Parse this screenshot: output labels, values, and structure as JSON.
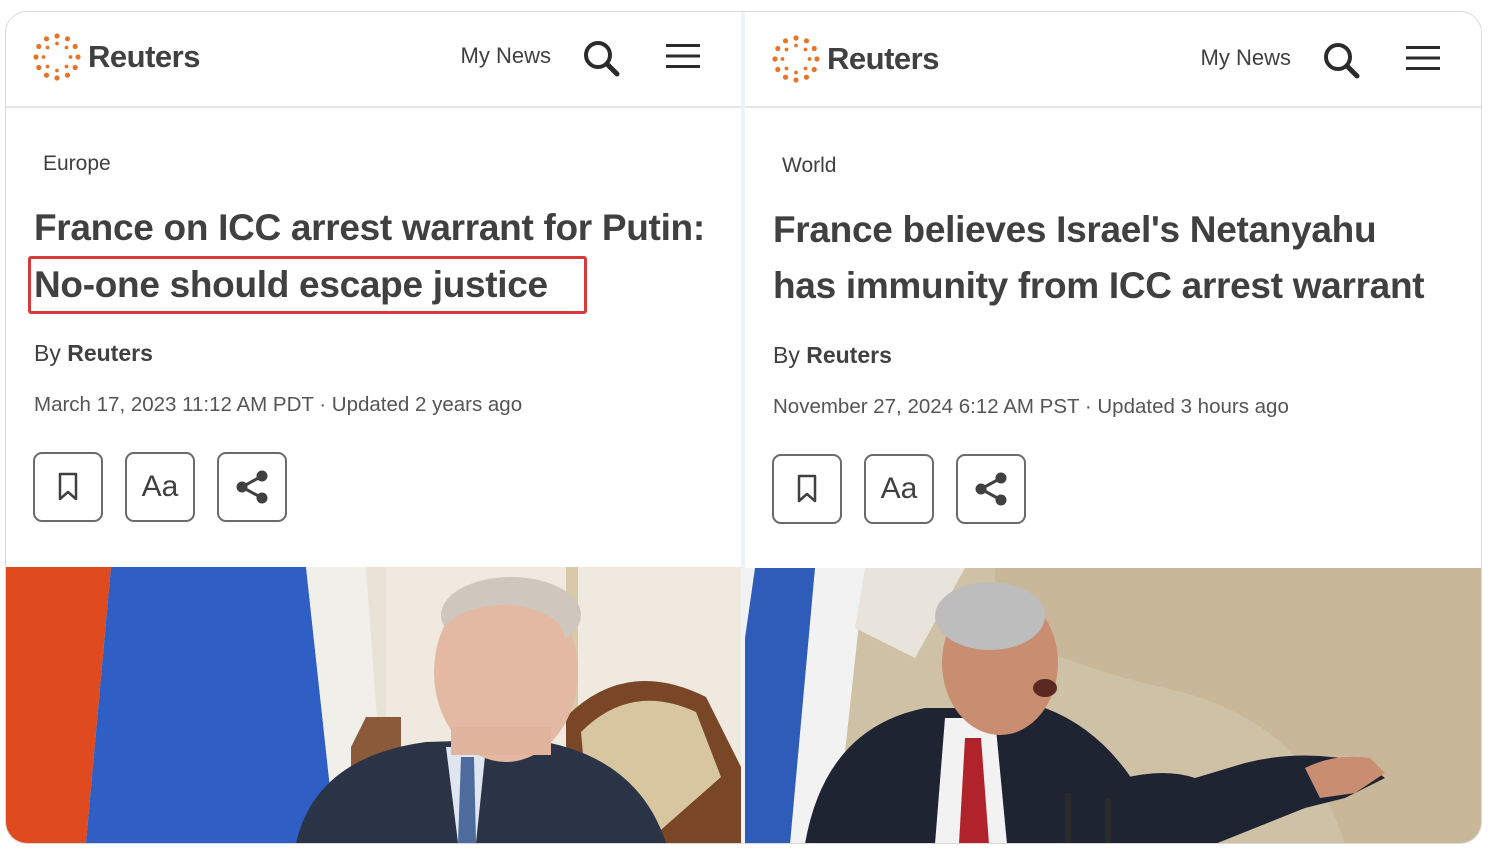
{
  "articles": [
    {
      "header": {
        "brand": "Reuters",
        "my_news": "My News"
      },
      "section": "Europe",
      "headline_line1": "France on ICC arrest warrant for Putin:",
      "headline_line2": "No-one should escape justice",
      "byline_prefix": "By",
      "byline_author": "Reuters",
      "dateline": "March 17, 2023 11:12 AM PDT · Updated 2 years ago",
      "text_size_label": "Aa",
      "photo_subject": "Vladimir Putin seated in front of Russian flag"
    },
    {
      "header": {
        "brand": "Reuters",
        "my_news": "My News"
      },
      "section": "World",
      "headline_line1": "France believes Israel's Netanyahu",
      "headline_line2": "has immunity from ICC arrest warrant",
      "byline_prefix": "By",
      "byline_author": "Reuters",
      "dateline": "November 27, 2024 6:12 AM PST · Updated 3 hours ago",
      "text_size_label": "Aa",
      "photo_subject": "Benjamin Netanyahu speaking and pointing in front of Israeli flag"
    }
  ],
  "colors": {
    "reuters_orange": "#e8742a",
    "highlight_red": "#d63a3a",
    "text": "#404040"
  },
  "icons": [
    "reuters-logo-icon",
    "search-icon",
    "menu-icon",
    "bookmark-icon",
    "share-icon"
  ]
}
